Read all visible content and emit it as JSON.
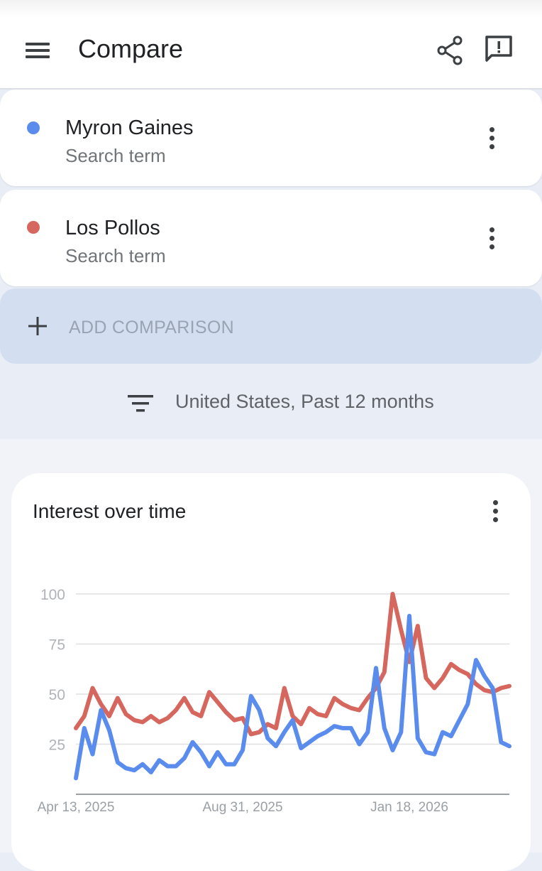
{
  "header": {
    "title": "Compare",
    "menu_icon": "menu-icon",
    "share_icon": "share-icon",
    "feedback_icon": "feedback-icon"
  },
  "terms": [
    {
      "name": "Myron Gaines",
      "type": "Search term",
      "color": "#5a8ced"
    },
    {
      "name": "Los Pollos",
      "type": "Search term",
      "color": "#d6675f"
    }
  ],
  "add_comparison": {
    "label": "ADD COMPARISON",
    "icon": "plus-icon"
  },
  "filter": {
    "label": "United States, Past 12 months",
    "icon": "filter-icon"
  },
  "chart_card": {
    "title": "Interest over time"
  },
  "chart_data": {
    "type": "line",
    "title": "Interest over time",
    "xlabel": "",
    "ylabel": "",
    "ylim": [
      0,
      100
    ],
    "y_ticks": [
      "100",
      "75",
      "50",
      "25"
    ],
    "x_tick_labels": [
      "Apr 13, 2025",
      "Aug 31, 2025",
      "Jan 18, 2026"
    ],
    "grid": true,
    "series": [
      {
        "name": "Myron Gaines",
        "color": "#5a8ced",
        "values": [
          8,
          33,
          20,
          42,
          32,
          16,
          13,
          12,
          15,
          11,
          17,
          14,
          14,
          18,
          26,
          21,
          14,
          21,
          15,
          15,
          22,
          49,
          42,
          28,
          24,
          31,
          37,
          23,
          26,
          29,
          31,
          34,
          33,
          33,
          25,
          31,
          63,
          33,
          22,
          31,
          89,
          28,
          21,
          20,
          31,
          29,
          37,
          45,
          67,
          59,
          53,
          26,
          24
        ]
      },
      {
        "name": "Los Pollos",
        "color": "#d6675f",
        "values": [
          33,
          39,
          53,
          45,
          39,
          48,
          40,
          37,
          36,
          39,
          36,
          38,
          42,
          48,
          41,
          39,
          51,
          46,
          41,
          37,
          38,
          30,
          31,
          35,
          33,
          53,
          39,
          35,
          43,
          40,
          39,
          48,
          45,
          43,
          42,
          48,
          53,
          61,
          100,
          82,
          66,
          84,
          58,
          53,
          58,
          65,
          62,
          60,
          55,
          52,
          51,
          53,
          54
        ]
      }
    ]
  }
}
